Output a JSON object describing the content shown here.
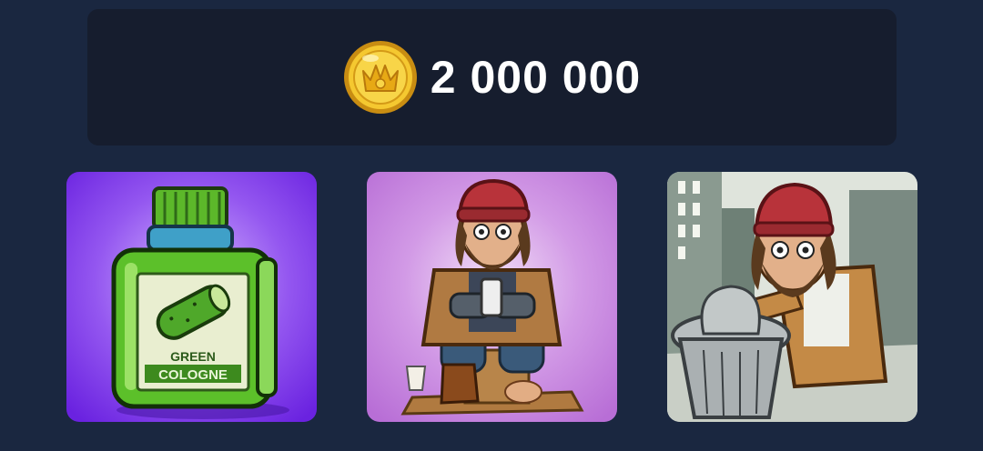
{
  "balance": {
    "amount": "2 000 000",
    "icon": "gold-crown-coin-icon",
    "colors": {
      "panel": "#161d2e",
      "coin": "#f2c12e",
      "text": "#ffffff"
    }
  },
  "items": [
    {
      "image": "green-cologne-bottle",
      "label_line1": "GREEN",
      "label_line2": "COLOGNE"
    },
    {
      "image": "homeless-man-with-phone"
    },
    {
      "image": "homeless-man-with-trash-can"
    }
  ],
  "colors": {
    "background": "#1a2740"
  }
}
